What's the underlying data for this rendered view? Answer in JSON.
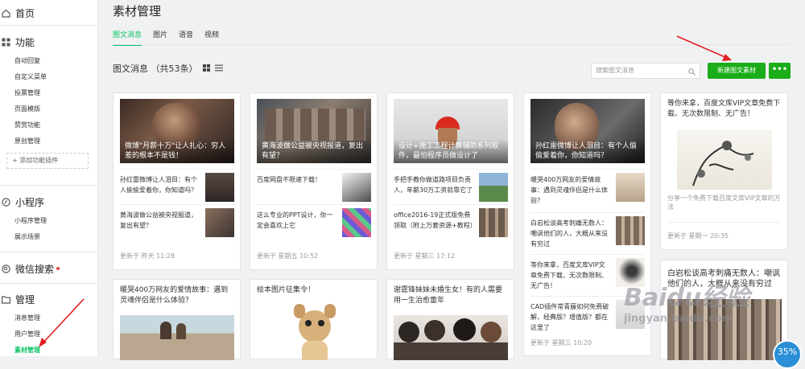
{
  "sidebar": {
    "home": "首页",
    "features": {
      "label": "功能",
      "items": [
        "自动回复",
        "自定义菜单",
        "投票管理",
        "页面模版",
        "赞赏功能",
        "原创管理"
      ],
      "add": "添加功能插件"
    },
    "miniprogram": {
      "label": "小程序",
      "items": [
        "小程序管理",
        "展示场景"
      ]
    },
    "wxsearch": {
      "label": "微信搜索"
    },
    "manage": {
      "label": "管理",
      "items": [
        "消息管理",
        "用户管理",
        "素材管理"
      ]
    }
  },
  "header": {
    "title": "素材管理",
    "tabs": [
      "图文消息",
      "图片",
      "语音",
      "视频"
    ],
    "count": "图文消息 （共53条）",
    "search_placeholder": "搜索图文消息",
    "new_btn": "新建图文素材",
    "more_btn": "•••"
  },
  "cards": [
    {
      "cover": "微博\"月薪十万\"让人扎心：穷人差的根本不是钱！",
      "subs": [
        "孙红雷微博让人泪目：有个人偷偷爱着你，你知道吗？",
        "黄海波做公益被央视报道，复出有望？"
      ],
      "update": "更新于 昨天 11:28"
    },
    {
      "cover": "黄海波做公益被央视报道，复出有望？",
      "subs": [
        "百度网盘不限速下载！",
        "这么专业的PPT设计，你一定会喜欢上它"
      ],
      "update": "更新于 星期五 10:52"
    },
    {
      "cover": "设计+施工工程计算辅助系列软件，最怕程序员做设计了",
      "subs": [
        "手把手教你做道路项目负责人，年薪30万工资就靠它了",
        "office2016-19正式版免费领取（附上万套资源+教程）"
      ],
      "update": "更新于 星期三 17:12"
    },
    {
      "cover": "孙红雷微博让人泪目：有个人偷偷爱着你，你知道吗？",
      "subs": [
        "暖哭400万网友的爱情故事：遇到灵魂伴侣是什么体验？",
        "白岩松谈高考刺痛无数人：嘲讽他们的人，大概从来没有穷过",
        "等你来拿，百度文库VIP文章免费下载、无次数限制、无广告！",
        "CAD插件常青藤如何免费破解，经典版？增值版？都在这里了"
      ],
      "update": "更新于 星期三 10:20"
    },
    {
      "title": "等你来拿，百度文库VIP文章免费下载、无次数限制、无广告！",
      "desc": "分享一个免费下载百度文库VIP文章的方法",
      "update": "更新于 星期一 20:35"
    },
    {
      "title": "暖哭400万网友的爱情故事：遇到灵魂伴侣是什么体验？"
    },
    {
      "title": "绘本图片征集令！"
    },
    {
      "title": "谢霆锋妹妹未婚生女！有的人需要用一生治愈童年"
    },
    {
      "title": "白岩松谈高考刺痛无数人：嘲讽他们的人，大概从来没有穷过"
    }
  ],
  "watermark": {
    "logo": "Baidu经验",
    "url": "jingyan.baidu.com"
  },
  "badge": "35%",
  "colors": {
    "accent": "#07c160",
    "button": "#1aad19",
    "red_dot": "#e64340"
  }
}
